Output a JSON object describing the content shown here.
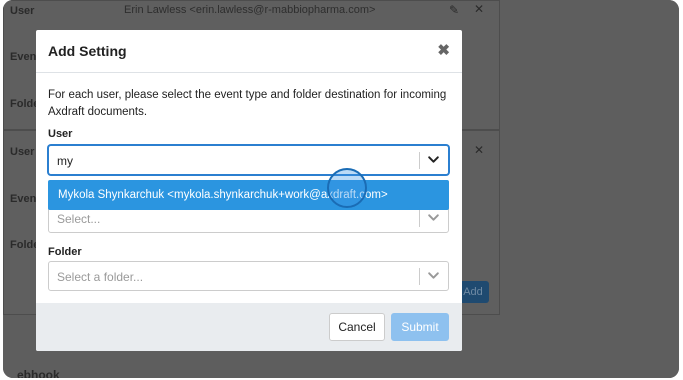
{
  "background": {
    "rows": [
      {
        "label": "User",
        "value": "Erin Lawless <erin.lawless@r-mabbiopharma.com>"
      },
      {
        "label": "Event"
      },
      {
        "label": "Folde"
      },
      {
        "label": "User"
      },
      {
        "label": "Event"
      },
      {
        "label": "Folde"
      }
    ],
    "add_label": "Add",
    "webhook_label": "ebhook"
  },
  "modal": {
    "title": "Add Setting",
    "close_glyph": "✖",
    "intro": "For each user, please select the event type and folder destination for incoming Axdraft documents.",
    "user_label": "User",
    "user_value": "my",
    "user_option": "Mykola Shynkarchuk <mykola.shynkarchuk+work@axdraft.com>",
    "event_placeholder": "Select...",
    "folder_label": "Folder",
    "folder_placeholder": "Select a folder...",
    "cancel_label": "Cancel",
    "submit_label": "Submit"
  },
  "colors": {
    "accent": "#2b95e0",
    "submit_disabled": "#8ec1ef",
    "overlay": "#5e5e5e"
  }
}
